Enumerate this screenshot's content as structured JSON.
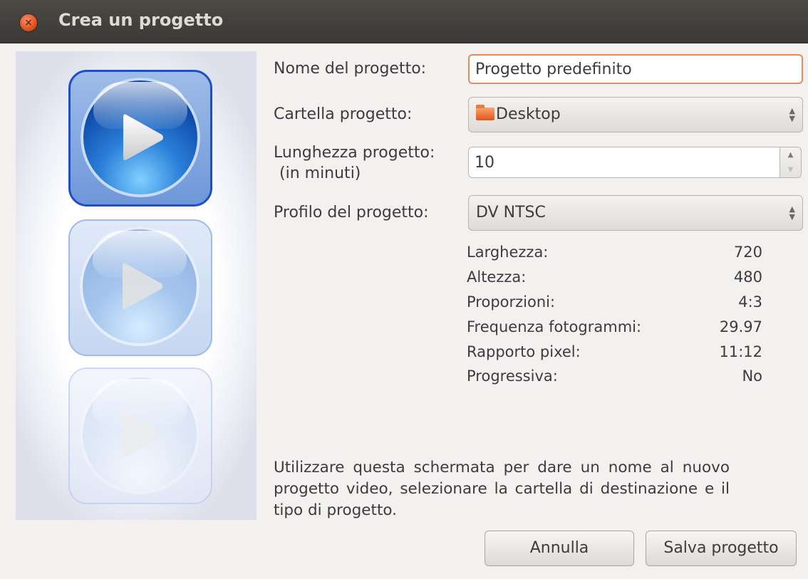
{
  "window": {
    "title": "Crea un progetto",
    "close_icon": "×"
  },
  "form": {
    "name_label": "Nome del progetto:",
    "name_value": "Progetto predefinito",
    "folder_label": "Cartella progetto:",
    "folder_value": "Desktop",
    "length_label_line1": "Lunghezza progetto:",
    "length_label_line2": "(in minuti)",
    "length_value": "10",
    "profile_label": "Profilo del progetto:",
    "profile_value": "DV NTSC"
  },
  "profile_details": [
    {
      "label": "Larghezza:",
      "value": "720"
    },
    {
      "label": "Altezza:",
      "value": "480"
    },
    {
      "label": "Proporzioni:",
      "value": "4:3"
    },
    {
      "label": "Frequenza fotogrammi:",
      "value": "29.97"
    },
    {
      "label": "Rapporto pixel:",
      "value": "11:12"
    },
    {
      "label": "Progressiva:",
      "value": "No"
    }
  ],
  "description": "Utilizzare questa schermata per dare un nome al nuovo progetto video, selezionare la cartella di destinazione e il tipo di progetto.",
  "buttons": {
    "cancel": "Annulla",
    "save": "Salva progetto"
  },
  "icons": {
    "combo_arrows": "▲\n▼",
    "folder": "folder-icon",
    "play": "play-icon"
  },
  "colors": {
    "titlebar": "#3e3d39",
    "focus_border": "#e58b58",
    "accent_blue": "#1e4fc8"
  }
}
